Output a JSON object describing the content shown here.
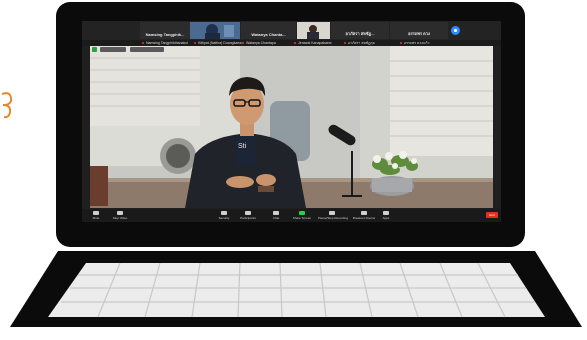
{
  "participants": [
    {
      "name": "Namsing  Tangphik...",
      "video": false
    },
    {
      "name": "",
      "video": true
    },
    {
      "name": "Watanya  Chanta...",
      "video": false
    },
    {
      "name": "",
      "video": true
    },
    {
      "name": "อาภัสรา  สหชัฏ...",
      "video": false
    },
    {
      "name": "อรรถพร  ดวง",
      "video": false
    }
  ],
  "tabs": [
    "Namsing Tangphikthanakul",
    "Kittipat (Nattha) Duangkaew",
    "Watanya Chantapa",
    "Jerawat Kanapakaew",
    "อาภัสรา สหชัฏกุล",
    "อรรถพร ดวงแก้ว"
  ],
  "controls": [
    {
      "label": "Mute"
    },
    {
      "label": "Stop Video"
    },
    {
      "label": "Security"
    },
    {
      "label": "Participants"
    },
    {
      "label": "Chat"
    },
    {
      "label": "Share Screen"
    },
    {
      "label": "Pause/Stop Recording"
    },
    {
      "label": "Breakout Rooms"
    },
    {
      "label": "Apps"
    }
  ],
  "end_label": "End",
  "colors": {
    "accent": "#2d8cff",
    "end": "#e0321c",
    "bezel": "#0b0b0b"
  }
}
